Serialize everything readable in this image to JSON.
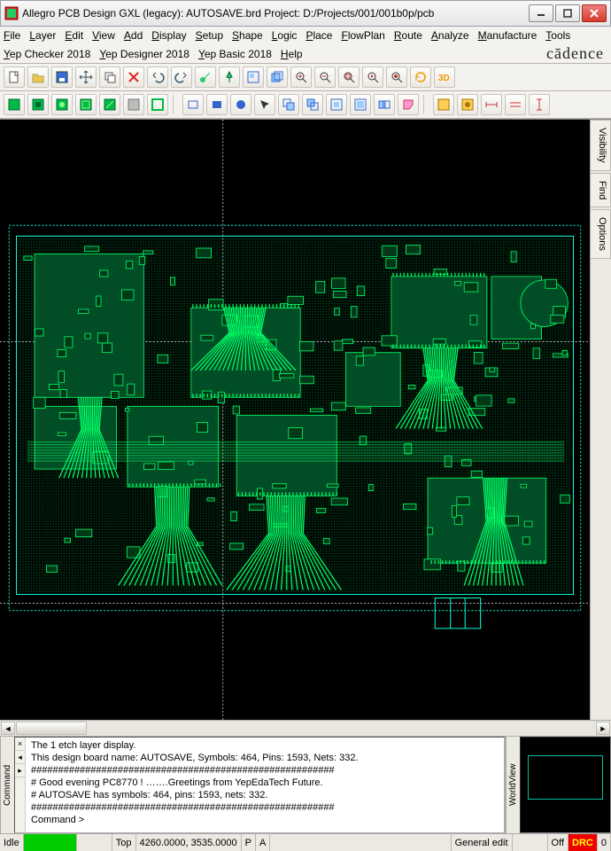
{
  "window": {
    "title": "Allegro PCB Design GXL (legacy): AUTOSAVE.brd  Project: D:/Projects/001/001b0p/pcb"
  },
  "menu": {
    "items": [
      "File",
      "Layer",
      "Edit",
      "View",
      "Add",
      "Display",
      "Setup",
      "Shape",
      "Logic",
      "Place",
      "FlowPlan",
      "Route",
      "Analyze",
      "Manufacture",
      "Tools",
      "Yep Checker 2018",
      "Yep Designer 2018",
      "Yep Basic 2018",
      "Help"
    ]
  },
  "brand": "cādence",
  "side_tabs": [
    "Visibility",
    "Find",
    "Options"
  ],
  "command_panel": {
    "label": "Command",
    "lines": [
      "The 1 etch layer display.",
      "This design board name: AUTOSAVE, Symbols: 464, Pins: 1593, Nets: 332.",
      "########################################################",
      "#  Good evening PC8770 !     …….Greetings from YepEdaTech Future.",
      "#  AUTOSAVE has symbols: 464, pins: 1593, nets: 332.",
      "########################################################",
      "Command >"
    ]
  },
  "worldview": {
    "label": "WorldView"
  },
  "status": {
    "mode": "Idle",
    "layer": "Top",
    "coords": "4260.0000, 3535.0000",
    "flags": [
      "P",
      "A"
    ],
    "edit_mode": "General edit",
    "drc_off": "Off",
    "drc_label": "DRC",
    "drc_count": "0"
  },
  "icons": {
    "tb1": [
      "new-file",
      "open-file",
      "save",
      "move-xy",
      "copy",
      "delete-x",
      "undo",
      "redo",
      "label-flag",
      "pin-flag",
      "window-area",
      "window-stack",
      "zoom-in",
      "zoom-out",
      "zoom-fit",
      "zoom-prev",
      "zoom-world",
      "refresh",
      "view-3d"
    ],
    "tb2": [
      "layer-on",
      "layer-copy",
      "layer-etch-a",
      "layer-etch-b",
      "layer-etch-c",
      "layer-gray",
      "layer-outline",
      "vsep",
      "rect",
      "rect-fill",
      "circle",
      "sel-arrow",
      "sel-overlap-a",
      "sel-overlap-b",
      "sel-in",
      "sel-out",
      "sel-touch",
      "sel-shape",
      "vsep",
      "net-a",
      "net-b",
      "dim-h",
      "dim-hh",
      "dim-v"
    ]
  }
}
